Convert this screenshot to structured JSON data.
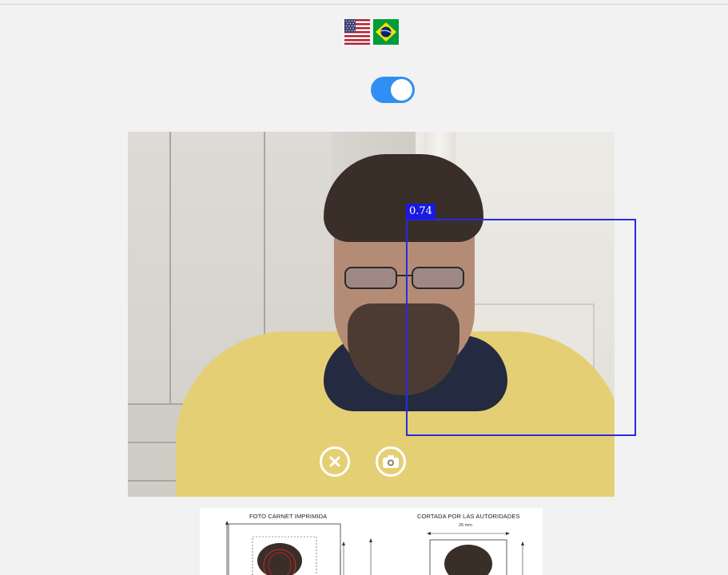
{
  "language_flags": [
    {
      "name": "English (US)",
      "icon": "us-flag-icon"
    },
    {
      "name": "Português (BR)",
      "icon": "brazil-flag-icon"
    }
  ],
  "toggle": {
    "state": "on",
    "color": "#2f8ff3"
  },
  "camera": {
    "detection": {
      "score": "0.74",
      "box_color": "#2a2ae6"
    },
    "controls": [
      {
        "name": "close",
        "icon": "close-icon"
      },
      {
        "name": "capture",
        "icon": "camera-icon"
      }
    ]
  },
  "reference": {
    "left_title": "FOTO CARNET IMPRIMIDA",
    "right_title": "CORTADA POR LAS AUTORIDADES",
    "right_dimension": "26 mm"
  }
}
